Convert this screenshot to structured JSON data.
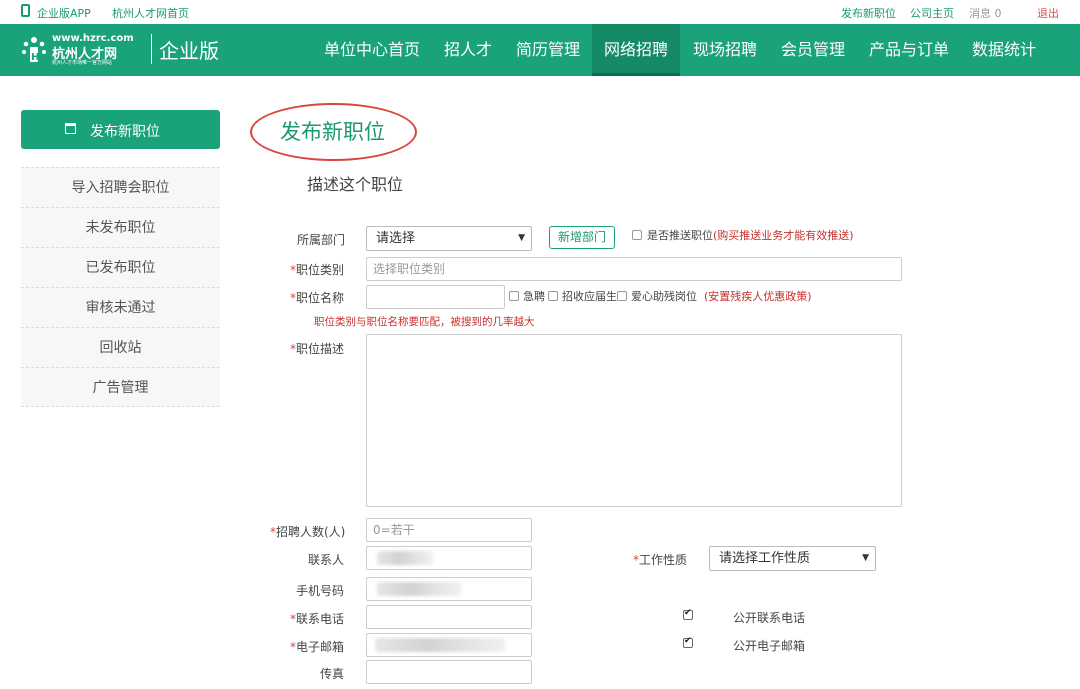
{
  "topbar": {
    "app_label": "企业版APP",
    "home_link": "杭州人才网首页",
    "post_job": "发布新职位",
    "company_home": "公司主页",
    "messages": "消息 0",
    "logout": "退出"
  },
  "header": {
    "logo_url": "www.hzrc.com",
    "logo_name": "杭州人才网",
    "logo_slogan": "杭州人才市场唯一官方网站",
    "edition": "企业版",
    "nav": [
      {
        "label": "单位中心首页"
      },
      {
        "label": "招人才"
      },
      {
        "label": "简历管理"
      },
      {
        "label": "网络招聘"
      },
      {
        "label": "现场招聘"
      },
      {
        "label": "会员管理"
      },
      {
        "label": "产品与订单"
      },
      {
        "label": "数据统计"
      }
    ]
  },
  "sidebar": {
    "primary": "发布新职位",
    "items": [
      {
        "label": "导入招聘会职位"
      },
      {
        "label": "未发布职位"
      },
      {
        "label": "已发布职位"
      },
      {
        "label": "审核未通过"
      },
      {
        "label": "回收站"
      },
      {
        "label": "广告管理"
      }
    ]
  },
  "main": {
    "title": "发布新职位",
    "subtitle": "描述这个职位"
  },
  "form": {
    "department_label": "所属部门",
    "department_value": "请选择",
    "add_department": "新增部门",
    "push_label": "是否推送职位",
    "push_note": "(购买推送业务才能有效推送)",
    "required_mark": "*",
    "category_label": "职位类别",
    "category_placeholder": "选择职位类别",
    "jobname_label": "职位名称",
    "urgent_label": "急聘",
    "fresh_grad_label": "招收应届生",
    "disabled_label": "爱心助残岗位",
    "disabled_note": "(安置残疾人优惠政策)",
    "hint": "职位类别与职位名称要匹配，被搜到的几率越大",
    "desc_label": "职位描述",
    "headcount_label": "招聘人数(人)",
    "headcount_placeholder": "0=若干",
    "contact_label": "联系人",
    "worktype_label": "工作性质",
    "worktype_value": "请选择工作性质",
    "mobile_label": "手机号码",
    "phone_label": "联系电话",
    "public_phone_label": "公开联系电话",
    "email_label": "电子邮箱",
    "public_email_label": "公开电子邮箱",
    "fax_label": "传真"
  },
  "colors": {
    "brand": "#1aa27a",
    "annotation": "#d9453f",
    "warning": "#c9302c"
  }
}
